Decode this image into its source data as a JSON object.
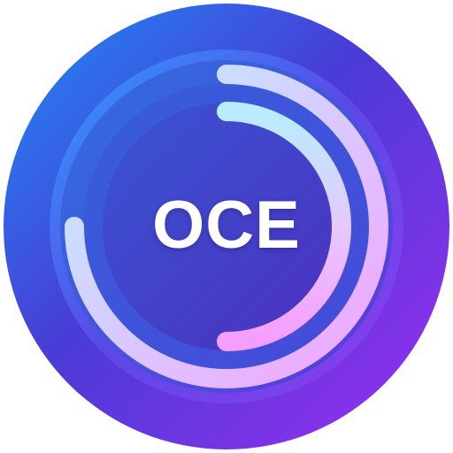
{
  "app_icon": {
    "label": "OCE",
    "colors": {
      "outer_start": "#2f7ff0",
      "outer_mid": "#4a3bd6",
      "outer_end": "#8a2ee8",
      "ring_band": "#3b3cc4",
      "inner_disc": "#4a34c2",
      "arc_light_blue": "#9fe0ff",
      "arc_pink": "#f0a6ff"
    },
    "decor": [
      "concentric-ring",
      "progress-arc"
    ]
  }
}
